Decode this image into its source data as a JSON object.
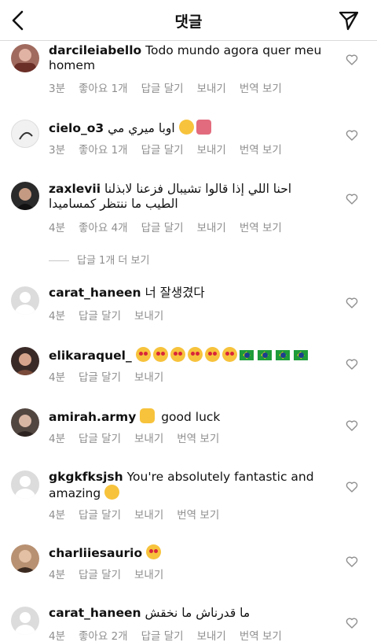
{
  "header": {
    "title": "댓글"
  },
  "labels": {
    "reply": "답글 달기",
    "send": "보내기",
    "translate": "번역 보기"
  },
  "view_more_replies": "답글 1개 더 보기",
  "comments": [
    {
      "user": "darcileiabello",
      "text": "Todo mundo agora quer meu homem",
      "time": "3분",
      "likes": "좋아요 1개"
    },
    {
      "user": "cielo_o3",
      "text": "اوبا ميري مي",
      "time": "3분",
      "likes": "좋아요 1개"
    },
    {
      "user": "zaxlevii",
      "text": "احنا اللي إذا قالوا تشيبال فزعنا  لابذلنا الطيب ما ننتظر كمساميدا",
      "time": "4분",
      "likes": "좋아요 4개"
    },
    {
      "user": "carat_haneen",
      "text": "너 잘생겼다",
      "time": "4분"
    },
    {
      "user": "elikaraquel_",
      "text": "",
      "time": "4분"
    },
    {
      "user": "amirah.army",
      "text": "good  luck",
      "time": "4분"
    },
    {
      "user": "gkgkfksjsh",
      "text": "You're absolutely fantastic and amazing",
      "time": "4분"
    },
    {
      "user": "charliiesaurio",
      "text": "",
      "time": "4분"
    },
    {
      "user": "carat_haneen",
      "text": "ما قدرناش ما نخقش",
      "time": "4분",
      "likes": "좋아요 2개"
    }
  ]
}
